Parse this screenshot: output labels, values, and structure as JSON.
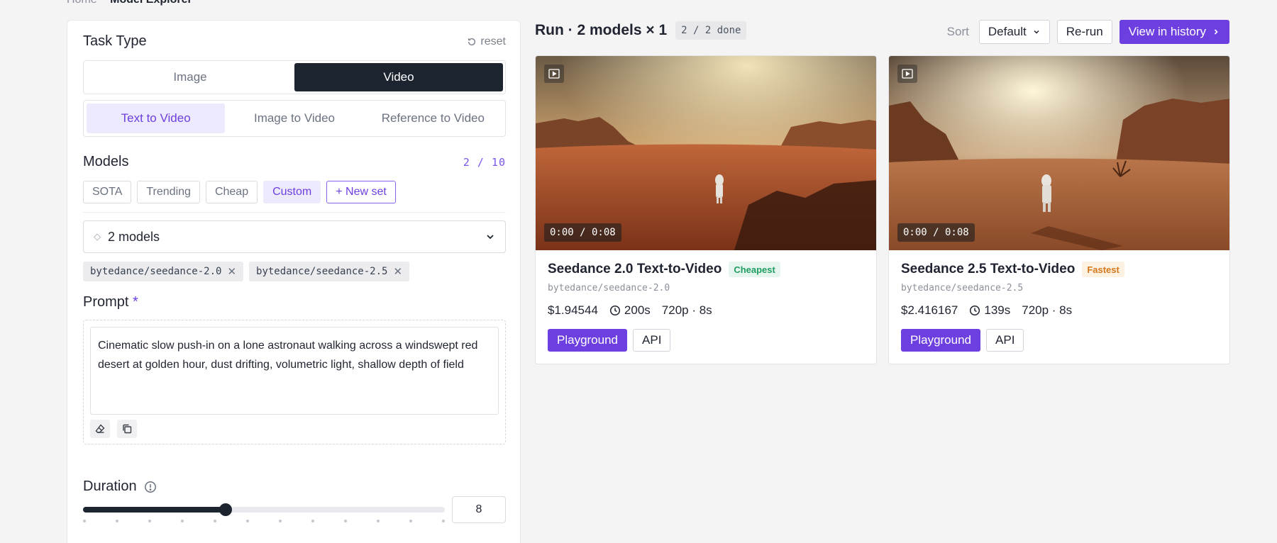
{
  "breadcrumb": {
    "home": "Home",
    "current": "Model Explorer"
  },
  "task": {
    "title": "Task Type",
    "reset": "reset",
    "modes": [
      "Image",
      "Video"
    ],
    "active_mode": "Video",
    "submodes": [
      "Text to Video",
      "Image to Video",
      "Reference to Video"
    ],
    "active_submode": "Text to Video"
  },
  "models": {
    "title": "Models",
    "count": "2 / 10",
    "presets": [
      "SOTA",
      "Trending",
      "Cheap",
      "Custom"
    ],
    "active_preset": "Custom",
    "new_set": "+ New set",
    "select_value": "2 models",
    "selected": [
      "bytedance/seedance-2.0",
      "bytedance/seedance-2.5"
    ]
  },
  "prompt": {
    "title": "Prompt",
    "required_mark": "*",
    "text": "Cinematic slow push-in on a lone astronaut walking across a windswept red desert at golden hour, dust drifting, volumetric light, shallow depth of field"
  },
  "duration": {
    "title": "Duration",
    "value": "8",
    "level_fraction": 0.395
  },
  "run": {
    "title": "Run · 2 models × 1",
    "status": "2 / 2 done",
    "sort_label": "Sort",
    "sort_value": "Default",
    "rerun": "Re-run",
    "history": "View in history"
  },
  "cards": [
    {
      "title": "Seedance 2.0 Text-to-Video",
      "badge": "Cheapest",
      "slug": "bytedance/seedance-2.0",
      "price": "$1.94544",
      "time": "200s",
      "spec": "720p · 8s",
      "video_time": "0:00 / 0:08",
      "playground": "Playground",
      "api": "API"
    },
    {
      "title": "Seedance 2.5 Text-to-Video",
      "badge": "Fastest",
      "slug": "bytedance/seedance-2.5",
      "price": "$2.416167",
      "time": "139s",
      "spec": "720p · 8s",
      "video_time": "0:00 / 0:08",
      "playground": "Playground",
      "api": "API"
    }
  ],
  "colors": {
    "accent": "#6d3fe0",
    "dark": "#1c2430",
    "cheapest": "#1f9d62",
    "fastest": "#d4771a"
  }
}
